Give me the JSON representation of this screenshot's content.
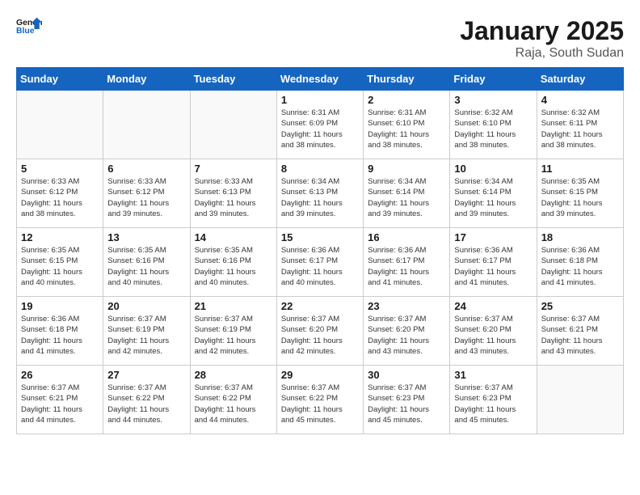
{
  "logo": {
    "text_general": "General",
    "text_blue": "Blue"
  },
  "title": "January 2025",
  "subtitle": "Raja, South Sudan",
  "days_of_week": [
    "Sunday",
    "Monday",
    "Tuesday",
    "Wednesday",
    "Thursday",
    "Friday",
    "Saturday"
  ],
  "weeks": [
    [
      {
        "day": "",
        "info": ""
      },
      {
        "day": "",
        "info": ""
      },
      {
        "day": "",
        "info": ""
      },
      {
        "day": "1",
        "info": "Sunrise: 6:31 AM\nSunset: 6:09 PM\nDaylight: 11 hours\nand 38 minutes."
      },
      {
        "day": "2",
        "info": "Sunrise: 6:31 AM\nSunset: 6:10 PM\nDaylight: 11 hours\nand 38 minutes."
      },
      {
        "day": "3",
        "info": "Sunrise: 6:32 AM\nSunset: 6:10 PM\nDaylight: 11 hours\nand 38 minutes."
      },
      {
        "day": "4",
        "info": "Sunrise: 6:32 AM\nSunset: 6:11 PM\nDaylight: 11 hours\nand 38 minutes."
      }
    ],
    [
      {
        "day": "5",
        "info": "Sunrise: 6:33 AM\nSunset: 6:12 PM\nDaylight: 11 hours\nand 38 minutes."
      },
      {
        "day": "6",
        "info": "Sunrise: 6:33 AM\nSunset: 6:12 PM\nDaylight: 11 hours\nand 39 minutes."
      },
      {
        "day": "7",
        "info": "Sunrise: 6:33 AM\nSunset: 6:13 PM\nDaylight: 11 hours\nand 39 minutes."
      },
      {
        "day": "8",
        "info": "Sunrise: 6:34 AM\nSunset: 6:13 PM\nDaylight: 11 hours\nand 39 minutes."
      },
      {
        "day": "9",
        "info": "Sunrise: 6:34 AM\nSunset: 6:14 PM\nDaylight: 11 hours\nand 39 minutes."
      },
      {
        "day": "10",
        "info": "Sunrise: 6:34 AM\nSunset: 6:14 PM\nDaylight: 11 hours\nand 39 minutes."
      },
      {
        "day": "11",
        "info": "Sunrise: 6:35 AM\nSunset: 6:15 PM\nDaylight: 11 hours\nand 39 minutes."
      }
    ],
    [
      {
        "day": "12",
        "info": "Sunrise: 6:35 AM\nSunset: 6:15 PM\nDaylight: 11 hours\nand 40 minutes."
      },
      {
        "day": "13",
        "info": "Sunrise: 6:35 AM\nSunset: 6:16 PM\nDaylight: 11 hours\nand 40 minutes."
      },
      {
        "day": "14",
        "info": "Sunrise: 6:35 AM\nSunset: 6:16 PM\nDaylight: 11 hours\nand 40 minutes."
      },
      {
        "day": "15",
        "info": "Sunrise: 6:36 AM\nSunset: 6:17 PM\nDaylight: 11 hours\nand 40 minutes."
      },
      {
        "day": "16",
        "info": "Sunrise: 6:36 AM\nSunset: 6:17 PM\nDaylight: 11 hours\nand 41 minutes."
      },
      {
        "day": "17",
        "info": "Sunrise: 6:36 AM\nSunset: 6:17 PM\nDaylight: 11 hours\nand 41 minutes."
      },
      {
        "day": "18",
        "info": "Sunrise: 6:36 AM\nSunset: 6:18 PM\nDaylight: 11 hours\nand 41 minutes."
      }
    ],
    [
      {
        "day": "19",
        "info": "Sunrise: 6:36 AM\nSunset: 6:18 PM\nDaylight: 11 hours\nand 41 minutes."
      },
      {
        "day": "20",
        "info": "Sunrise: 6:37 AM\nSunset: 6:19 PM\nDaylight: 11 hours\nand 42 minutes."
      },
      {
        "day": "21",
        "info": "Sunrise: 6:37 AM\nSunset: 6:19 PM\nDaylight: 11 hours\nand 42 minutes."
      },
      {
        "day": "22",
        "info": "Sunrise: 6:37 AM\nSunset: 6:20 PM\nDaylight: 11 hours\nand 42 minutes."
      },
      {
        "day": "23",
        "info": "Sunrise: 6:37 AM\nSunset: 6:20 PM\nDaylight: 11 hours\nand 43 minutes."
      },
      {
        "day": "24",
        "info": "Sunrise: 6:37 AM\nSunset: 6:20 PM\nDaylight: 11 hours\nand 43 minutes."
      },
      {
        "day": "25",
        "info": "Sunrise: 6:37 AM\nSunset: 6:21 PM\nDaylight: 11 hours\nand 43 minutes."
      }
    ],
    [
      {
        "day": "26",
        "info": "Sunrise: 6:37 AM\nSunset: 6:21 PM\nDaylight: 11 hours\nand 44 minutes."
      },
      {
        "day": "27",
        "info": "Sunrise: 6:37 AM\nSunset: 6:22 PM\nDaylight: 11 hours\nand 44 minutes."
      },
      {
        "day": "28",
        "info": "Sunrise: 6:37 AM\nSunset: 6:22 PM\nDaylight: 11 hours\nand 44 minutes."
      },
      {
        "day": "29",
        "info": "Sunrise: 6:37 AM\nSunset: 6:22 PM\nDaylight: 11 hours\nand 45 minutes."
      },
      {
        "day": "30",
        "info": "Sunrise: 6:37 AM\nSunset: 6:23 PM\nDaylight: 11 hours\nand 45 minutes."
      },
      {
        "day": "31",
        "info": "Sunrise: 6:37 AM\nSunset: 6:23 PM\nDaylight: 11 hours\nand 45 minutes."
      },
      {
        "day": "",
        "info": ""
      }
    ]
  ]
}
